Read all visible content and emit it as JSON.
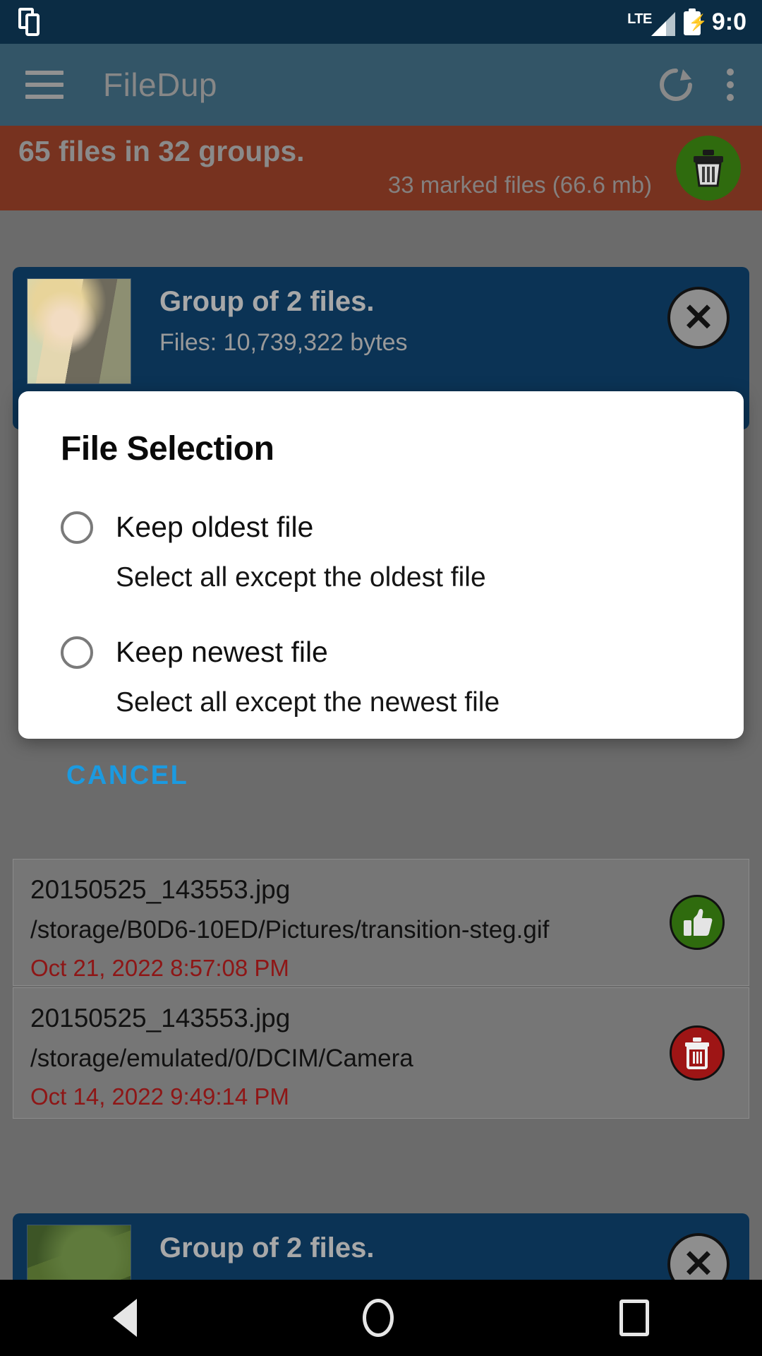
{
  "status_bar": {
    "multiwindow_icon": "multi-window-icon",
    "network": "LTE",
    "signal_icon": "signal-bars-icon",
    "battery_icon": "battery-charging-icon",
    "time": "9:0"
  },
  "app_bar": {
    "menu_icon": "hamburger-menu-icon",
    "title": "FileDup",
    "refresh_icon": "refresh-icon",
    "overflow_icon": "overflow-menu-icon"
  },
  "summary": {
    "files_line": "65 files in 32 groups.",
    "marked_line": "33 marked files (66.6 mb)",
    "delete_icon": "trash-icon"
  },
  "groups": [
    {
      "title": "Group of 2 files.",
      "size_label": "Files:  10,739,322 bytes",
      "thumbnail": "photo-thumbnail",
      "close_icon": "close-x-icon"
    },
    {
      "title": "Group of 2 files.",
      "size_label": "",
      "thumbnail": "photo-thumbnail",
      "close_icon": "close-x-icon"
    }
  ],
  "files": [
    {
      "name": "20150525_143553.jpg",
      "path": "/storage/B0D6-10ED/Pictures/transition-steg.gif",
      "date": "Oct 21, 2022 8:57:08 PM",
      "badge_icon": "thumbs-up-icon",
      "badge_state": "keep"
    },
    {
      "name": "20150525_143553.jpg",
      "path": "/storage/emulated/0/DCIM/Camera",
      "date": "Oct 14, 2022 9:49:14 PM",
      "badge_icon": "trash-icon",
      "badge_state": "delete"
    }
  ],
  "dialog": {
    "title": "File Selection",
    "options": [
      {
        "label": "Keep oldest file",
        "description": "Select all except the oldest file",
        "selected": false
      },
      {
        "label": "Keep newest file",
        "description": "Select all except the newest file",
        "selected": false
      }
    ],
    "cancel_label": "CANCEL"
  },
  "nav_bar": {
    "back_icon": "back-triangle-icon",
    "home_icon": "home-circle-icon",
    "recents_icon": "recents-square-icon"
  },
  "colors": {
    "status_bar": "#0b2c44",
    "app_bar": "#0c5175",
    "summary_banner": "#8d2305",
    "group_card": "#0b3355",
    "keep_badge": "#2f6b0e",
    "delete_badge": "#9e1515",
    "date_text": "#8e1616",
    "cancel_text": "#1b9ae0",
    "scrim": "#6b6b6b"
  }
}
